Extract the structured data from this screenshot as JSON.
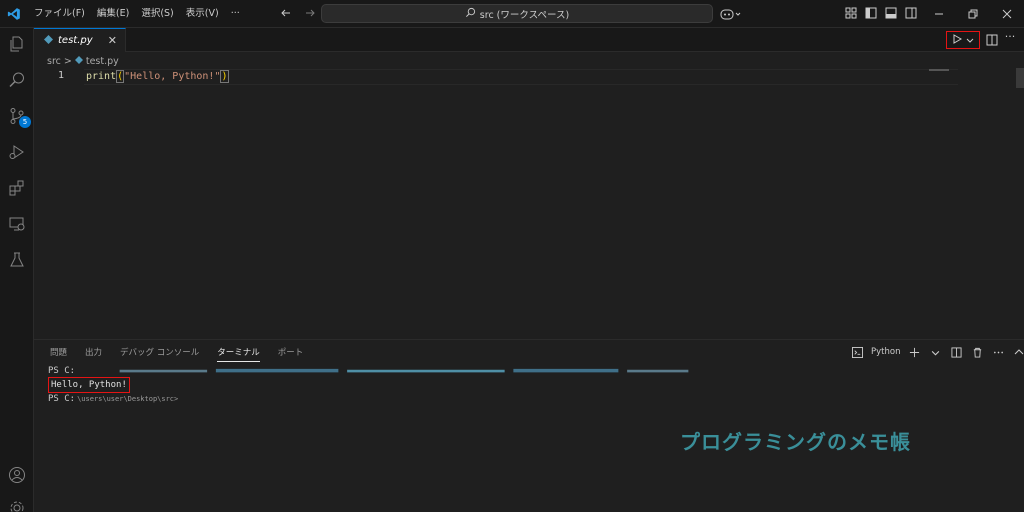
{
  "app": {
    "menu": [
      "ファイル(F)",
      "編集(E)",
      "選択(S)",
      "表示(V)",
      "···"
    ],
    "search_text": "src (ワークスペース)"
  },
  "editor_tab": {
    "label": "test.py",
    "close": "✕"
  },
  "breadcrumb": {
    "folder": "src",
    "separator": ">",
    "file": "test.py"
  },
  "code": {
    "line_number": "1",
    "fn": "print",
    "open": "(",
    "string": "\"Hello, Python!\"",
    "close": ")"
  },
  "panel": {
    "tabs": [
      "問題",
      "出力",
      "デバッグ コンソール",
      "ターミナル",
      "ポート"
    ],
    "active_tab": "ターミナル",
    "terminal_name": "Python"
  },
  "terminal": {
    "prompt1": "PS C:",
    "output": "Hello, Python!",
    "prompt2": "PS C:",
    "prompt2_path": "\\users\\user\\Desktop\\src>"
  },
  "scm_badge": "5",
  "watermark": "プログラミングのメモ帳",
  "colors": {
    "accent": "#0078d4",
    "highlight_box": "#e51414",
    "watermark": "#3a8f99"
  }
}
